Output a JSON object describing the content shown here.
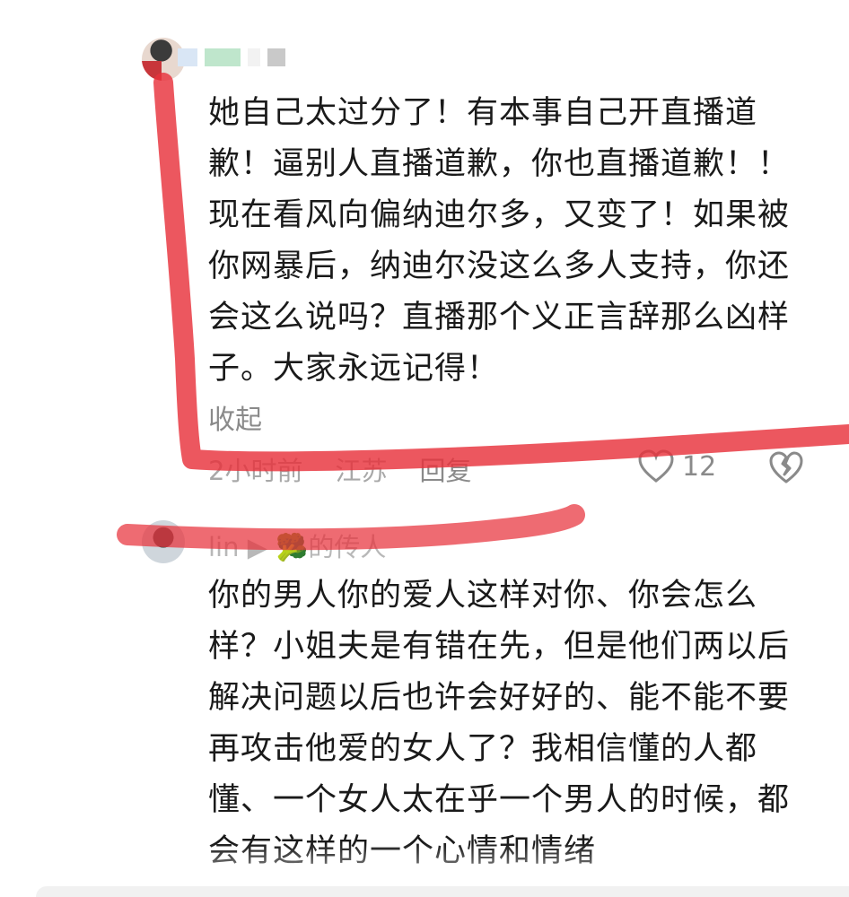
{
  "comments": [
    {
      "body": "她自己太过分了！有本事自己开直播道歉！逼别人直播道歉，你也直播道歉！！现在看风向偏纳迪尔多，又变了！如果被你网暴后，纳迪尔没这么多人支持，你还会这么说吗？直播那个义正言辞那么凶样子。大家永远记得！",
      "collapse_label": "收起",
      "time": "2小时前",
      "location": "江苏",
      "reply_label": "回复",
      "like_count": "12"
    },
    {
      "username": "lin ▶ 🥦的传人",
      "body": "你的男人你的爱人这样对你、你会怎么样？小姐夫是有错在先，但是他们两以后解决问题以后也许会好好的、能不能不要再攻击他爱的女人了？我相信懂的人都懂、一个女人太在乎一个男人的时候，都会有这样的一个心情和情绪"
    }
  ],
  "colors": {
    "annotation_stroke": "#e8323c",
    "text_primary": "#1a1a1a",
    "text_secondary": "#8a8a8a"
  }
}
